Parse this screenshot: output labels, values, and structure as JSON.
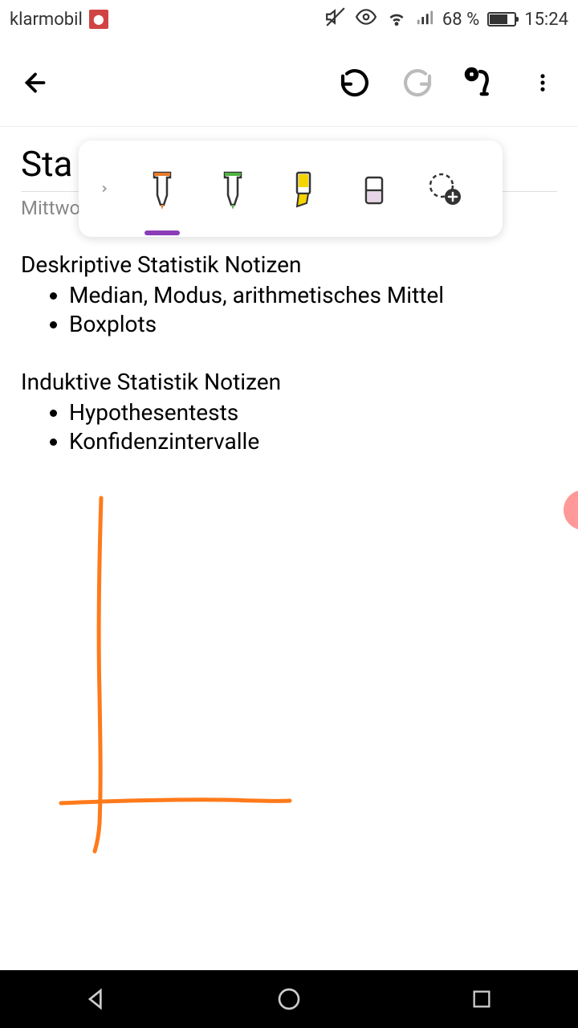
{
  "status": {
    "carrier": "klarmobil",
    "battery_text": "68 %",
    "time": "15:24"
  },
  "page": {
    "title_partial": "Sta",
    "date_partial": "Mittwo"
  },
  "sections": [
    {
      "heading": "Deskriptive Statistik Notizen",
      "items": [
        "Median, Modus, arithmetisches Mittel",
        "Boxplots"
      ]
    },
    {
      "heading": "Induktive Statistik Notizen",
      "items": [
        "Hypothesentests",
        "Konfidenzintervalle"
      ]
    }
  ],
  "pen_toolbar": {
    "tools": [
      {
        "name": "pen-orange",
        "color": "#e87a2e"
      },
      {
        "name": "pen-green",
        "color": "#4fb342"
      },
      {
        "name": "highlighter-yellow",
        "color": "#f5d400"
      },
      {
        "name": "eraser",
        "color": "#e8d4e8"
      },
      {
        "name": "lasso-add",
        "color": "#333"
      }
    ],
    "selected_index": 0
  },
  "drawing": {
    "stroke_color": "#ff7a1a"
  }
}
